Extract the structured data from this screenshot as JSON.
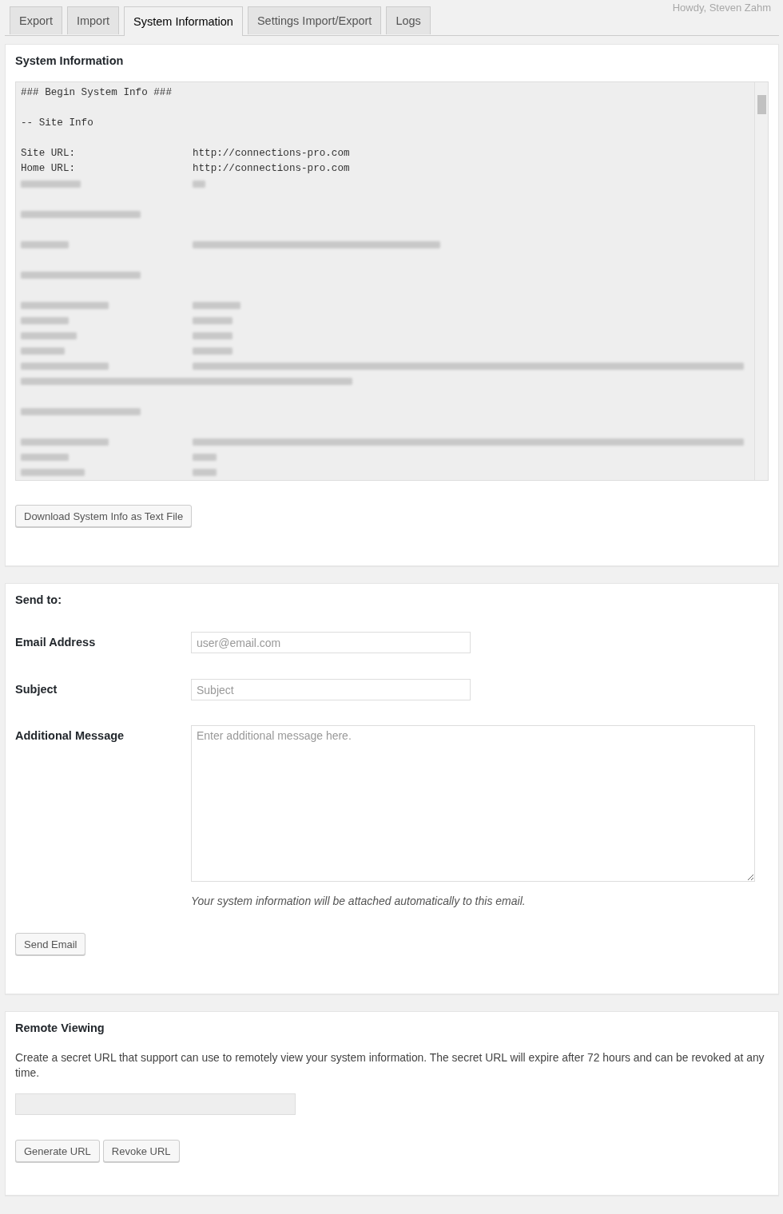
{
  "greeting": "Howdy, Steven Zahm",
  "tabs": [
    {
      "label": "Export",
      "selected": false
    },
    {
      "label": "Import",
      "selected": false
    },
    {
      "label": "System Information",
      "selected": true
    },
    {
      "label": "Settings Import/Export",
      "selected": false
    },
    {
      "label": "Logs",
      "selected": false
    }
  ],
  "system_info": {
    "title": "System Information",
    "lines": [
      {
        "kind": "text",
        "label": "### Begin System Info ###"
      },
      {
        "kind": "blank"
      },
      {
        "kind": "text",
        "label": "-- Site Info"
      },
      {
        "kind": "blank"
      },
      {
        "kind": "text",
        "label": "Site URL:",
        "value": "http://connections-pro.com"
      },
      {
        "kind": "text",
        "label": "Home URL:",
        "value": "http://connections-pro.com"
      },
      {
        "kind": "blurred-pair"
      },
      {
        "kind": "blank"
      },
      {
        "kind": "blurred-heading"
      },
      {
        "kind": "blank"
      },
      {
        "kind": "blurred-pair"
      },
      {
        "kind": "blank"
      },
      {
        "kind": "blurred-heading"
      },
      {
        "kind": "blank"
      },
      {
        "kind": "blurred-pair"
      },
      {
        "kind": "blurred-pair"
      },
      {
        "kind": "blurred-pair"
      },
      {
        "kind": "blurred-pair"
      },
      {
        "kind": "blurred-long"
      },
      {
        "kind": "blurred-wrap"
      },
      {
        "kind": "blank"
      },
      {
        "kind": "blurred-heading"
      },
      {
        "kind": "blank"
      },
      {
        "kind": "blurred-pair"
      },
      {
        "kind": "blurred-pair"
      },
      {
        "kind": "blurred-pair"
      }
    ],
    "download_button": "Download System Info as Text File"
  },
  "send_to": {
    "title": "Send to:",
    "fields": [
      {
        "kind": "input",
        "label": "Email Address",
        "placeholder": "user@email.com"
      },
      {
        "kind": "input",
        "label": "Subject",
        "placeholder": "Subject"
      },
      {
        "kind": "textarea",
        "label": "Additional Message",
        "placeholder": "Enter additional message here.",
        "note": "Your system information will be attached automatically to this email."
      }
    ],
    "send_button": "Send Email"
  },
  "remote_viewing": {
    "title": "Remote Viewing",
    "description": "Create a secret URL that support can use to remotely view your system information. The secret URL will expire after 72 hours and can be revoked at any time.",
    "buttons": [
      "Generate URL",
      "Revoke URL"
    ]
  }
}
